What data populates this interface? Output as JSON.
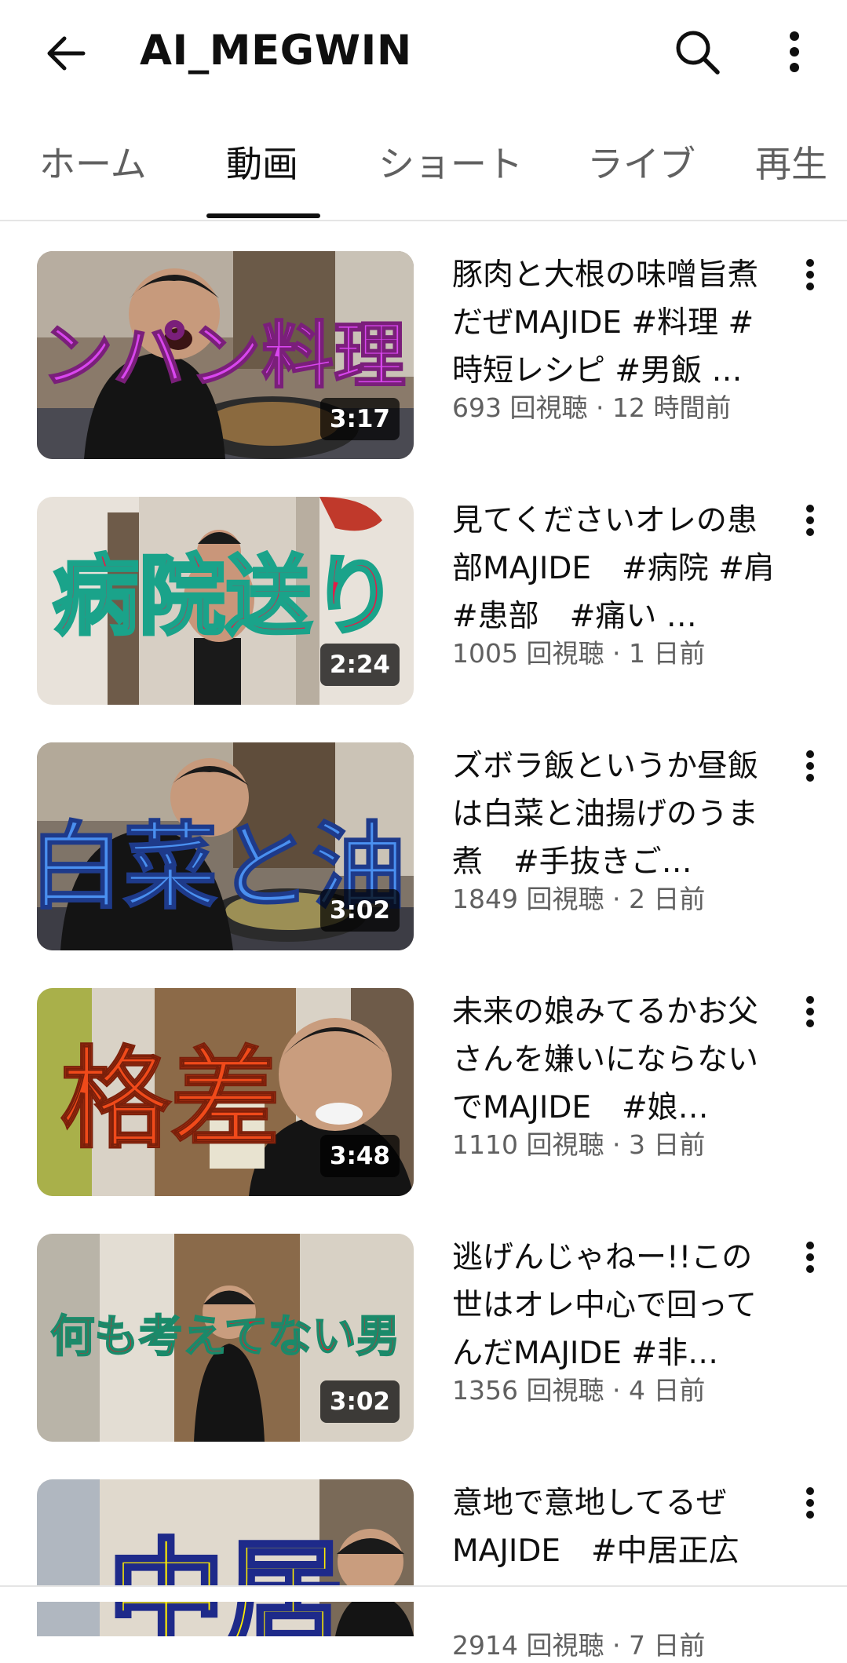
{
  "header": {
    "back_icon": "arrow-left-icon",
    "title": "AI_MEGWIN",
    "search_icon": "search-icon",
    "more_icon": "more-vertical-icon"
  },
  "tabs": [
    {
      "label": "ホーム",
      "active": false
    },
    {
      "label": "動画",
      "active": true
    },
    {
      "label": "ショート",
      "active": false
    },
    {
      "label": "ライブ",
      "active": false
    },
    {
      "label": "再生",
      "active": false
    }
  ],
  "videos": [
    {
      "title": "豚肉と大根の味噌旨煮だぜMAJIDE #料理 #時短レシピ #男飯 …",
      "meta": "693 回視聴 · 12 時間前",
      "duration": "3:17",
      "thumb_text": "ワンパン料理",
      "thumb_text_color": "#d946ef"
    },
    {
      "title": "見てくださいオレの患部MAJIDE　#病院 #肩　#患部　#痛い …",
      "meta": "1005 回視聴 · 1 日前",
      "duration": "2:24",
      "thumb_text": "病院送り",
      "thumb_text_color": "#e11d48"
    },
    {
      "title": "ズボラ飯というか昼飯は白菜と油揚げのうま煮　#手抜きご…",
      "meta": "1849 回視聴 · 2 日前",
      "duration": "3:02",
      "thumb_text": "白菜と油",
      "thumb_text_color": "#3b82f6"
    },
    {
      "title": "未来の娘みてるかお父さんを嫌いにならないでMAJIDE　#娘…",
      "meta": "1110 回視聴 · 3 日前",
      "duration": "3:48",
      "thumb_text": "格差",
      "thumb_text_color": "#f04a1a"
    },
    {
      "title": "逃げんじゃねー!!この世はオレ中心で回ってんだMAJIDE #非…",
      "meta": "1356 回視聴 · 4 日前",
      "duration": "3:02",
      "thumb_text": "何も考えてない男",
      "thumb_text_color": "#e11d2a"
    },
    {
      "title": "意地で意地してるぜMAJIDE　#中居正広",
      "meta": "2914 回視聴 · 7 日前",
      "duration": "",
      "thumb_text": "中居",
      "thumb_text_color": "#ffee00"
    }
  ]
}
